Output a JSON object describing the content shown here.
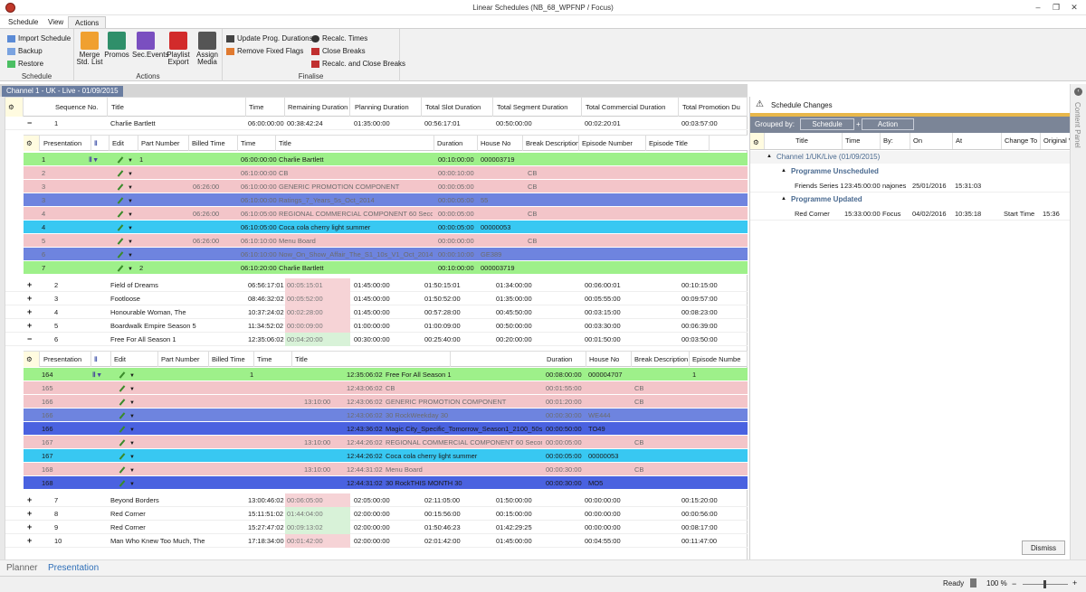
{
  "window": {
    "title": "Linear Schedules (NB_68_WPFNP / Focus)",
    "minimize": "–",
    "restore": "❐",
    "close": "✕"
  },
  "menu": {
    "tabs": [
      "Schedule",
      "View",
      "Actions"
    ],
    "active": "Actions"
  },
  "ribbon": {
    "schedule_group": {
      "label": "Schedule",
      "import": "Import Schedule",
      "backup": "Backup",
      "restore": "Restore"
    },
    "actions_group": {
      "label": "Actions",
      "merge": "Merge Std. List",
      "promos": "Promos",
      "sec_events": "Sec.Events",
      "playlist_export": "Playlist Export",
      "assign_media": "Assign Media"
    },
    "finalise_group": {
      "label": "Finalise",
      "update_prog": "Update Prog. Durations",
      "remove_fixed": "Remove Fixed Flags",
      "recalc_times": "Recalc. Times",
      "close_breaks": "Close Breaks",
      "recalc_close": "Recalc. and Close Breaks"
    }
  },
  "doc_tab": "Channel 1 - UK - Live - 01/09/2015",
  "main_headers": [
    "Sequence No.",
    "Title",
    "Time",
    "Remaining Duration",
    "Planning Duration",
    "Total Slot Duration",
    "Total Segment Duration",
    "Total Commercial Duration",
    "Total Promotion Du"
  ],
  "sub_headers_1": [
    "Presentation",
    "Edit",
    "Part Number",
    "Billed Time",
    "Time",
    "Title",
    "Duration",
    "House No",
    "Break Description",
    "Episode Number",
    "Episode Title"
  ],
  "sub_headers_2": [
    "Presentation",
    "Edit",
    "Part Number",
    "Billed Time",
    "Time",
    "Title",
    "Duration",
    "House No",
    "Break Description",
    "Episode Numbe"
  ],
  "programmes_top": [
    {
      "expander": "−",
      "seq": "1",
      "title": "Charlie Bartlett",
      "time": "06:00:00:00",
      "remaining": "00:38:42:24",
      "planning": "01:35:00:00",
      "slot": "00:56:17:01",
      "segment": "00:50:00:00",
      "commercial": "00:02:20:01",
      "promotion": "00:03:57:00"
    }
  ],
  "events_1": [
    {
      "color": "green",
      "pres": "1",
      "part": "1",
      "billed": "",
      "time": "06:00:00:00",
      "title": "Charlie Bartlett",
      "duration": "00:10:00:00",
      "house": "000003719",
      "brk": ""
    },
    {
      "color": "pink",
      "pres": "2",
      "part": "",
      "billed": "",
      "time": "06:10:00:00",
      "title": "CB",
      "duration": "00:00:10:00",
      "house": "",
      "brk": "CB"
    },
    {
      "color": "pink",
      "pres": "3",
      "part": "",
      "billed": "06:26:00",
      "time": "06:10:00:00",
      "title": "GENERIC PROMOTION COMPONENT",
      "duration": "00:00:05:00",
      "house": "",
      "brk": "CB"
    },
    {
      "color": "blue",
      "pres": "3",
      "part": "",
      "billed": "",
      "time": "06:10:00:00",
      "title": "Ratings_7_Years_5s_Oct_2014",
      "duration": "00:00:05:00",
      "house": "55",
      "brk": ""
    },
    {
      "color": "pink",
      "pres": "4",
      "part": "",
      "billed": "06:26:00",
      "time": "06:10:05:00",
      "title": "REGIONAL COMMERCIAL COMPONENT 60 Seconds",
      "duration": "00:00:05:00",
      "house": "",
      "brk": "CB"
    },
    {
      "color": "cyan",
      "pres": "4",
      "part": "",
      "billed": "",
      "time": "06:10:05:00",
      "title": "Coca cola cherry light summer",
      "duration": "00:00:05:00",
      "house": "00000053",
      "brk": ""
    },
    {
      "color": "pink",
      "pres": "5",
      "part": "",
      "billed": "06:26:00",
      "time": "06:10:10:00",
      "title": "Menu Board",
      "duration": "00:00:00:00",
      "house": "",
      "brk": "CB"
    },
    {
      "color": "blue",
      "pres": "6",
      "part": "",
      "billed": "",
      "time": "06:10:10:00",
      "title": "Now_On_Show_Affair_The_S1_10s_V1_Oct_2014",
      "duration": "00:00:10:00",
      "house": "GE389",
      "brk": ""
    },
    {
      "color": "green",
      "pres": "7",
      "part": "2",
      "billed": "",
      "time": "06:10:20:00",
      "title": "Charlie Bartlett",
      "duration": "00:10:00:00",
      "house": "000003719",
      "brk": ""
    }
  ],
  "programmes_mid": [
    {
      "expander": "+",
      "seq": "2",
      "title": "Field of Dreams",
      "time": "06:56:17:01",
      "remaining": "00:05:15:01",
      "rem_color": "pink",
      "planning": "01:45:00:00",
      "slot": "01:50:15:01",
      "segment": "01:34:00:00",
      "commercial": "00:06:00:01",
      "promotion": "00:10:15:00"
    },
    {
      "expander": "+",
      "seq": "3",
      "title": "Footloose",
      "time": "08:46:32:02",
      "remaining": "00:05:52:00",
      "rem_color": "pink",
      "planning": "01:45:00:00",
      "slot": "01:50:52:00",
      "segment": "01:35:00:00",
      "commercial": "00:05:55:00",
      "promotion": "00:09:57:00"
    },
    {
      "expander": "+",
      "seq": "4",
      "title": "Honourable Woman, The",
      "time": "10:37:24:02",
      "remaining": "00:02:28:00",
      "rem_color": "pink",
      "planning": "01:45:00:00",
      "slot": "00:57:28:00",
      "segment": "00:45:50:00",
      "commercial": "00:03:15:00",
      "promotion": "00:08:23:00"
    },
    {
      "expander": "+",
      "seq": "5",
      "title": "Boardwalk Empire Season 5",
      "time": "11:34:52:02",
      "remaining": "00:00:09:00",
      "rem_color": "pink",
      "planning": "01:00:00:00",
      "slot": "01:00:09:00",
      "segment": "00:50:00:00",
      "commercial": "00:03:30:00",
      "promotion": "00:06:39:00"
    },
    {
      "expander": "−",
      "seq": "6",
      "title": "Free For All Season 1",
      "time": "12:35:06:02",
      "remaining": "00:04:20:00",
      "rem_color": "green",
      "planning": "00:30:00:00",
      "slot": "00:25:40:00",
      "segment": "00:20:00:00",
      "commercial": "00:01:50:00",
      "promotion": "00:03:50:00"
    }
  ],
  "events_2": [
    {
      "color": "green",
      "pres": "164",
      "part": "1",
      "billed": "",
      "time": "12:35:06:02",
      "title": "Free For All Season 1",
      "duration": "00:08:00:00",
      "house": "000004707",
      "brk": "",
      "ep": "1"
    },
    {
      "color": "pink",
      "pres": "165",
      "part": "",
      "billed": "",
      "time": "12:43:06:02",
      "title": "CB",
      "duration": "00:01:55:00",
      "house": "",
      "brk": "CB",
      "ep": ""
    },
    {
      "color": "pink",
      "pres": "166",
      "part": "",
      "billed": "13:10:00",
      "time": "12:43:06:02",
      "title": "GENERIC PROMOTION COMPONENT",
      "duration": "00:01:20:00",
      "house": "",
      "brk": "CB",
      "ep": ""
    },
    {
      "color": "blue",
      "pres": "166",
      "part": "",
      "billed": "",
      "time": "12:43:06:02",
      "title": "30 RockWeekday 30",
      "duration": "00:00:30:00",
      "house": "WE444",
      "brk": "",
      "ep": ""
    },
    {
      "color": "dblue",
      "pres": "166",
      "part": "",
      "billed": "",
      "time": "12:43:36:02",
      "title": "Magic City_Specific_Tomorrow_Season1_2100_50s",
      "duration": "00:00:50:00",
      "house": "TO49",
      "brk": "",
      "ep": ""
    },
    {
      "color": "pink",
      "pres": "167",
      "part": "",
      "billed": "13:10:00",
      "time": "12:44:26:02",
      "title": "REGIONAL COMMERCIAL COMPONENT 60 Seconds",
      "duration": "00:00:05:00",
      "house": "",
      "brk": "CB",
      "ep": ""
    },
    {
      "color": "cyan",
      "pres": "167",
      "part": "",
      "billed": "",
      "time": "12:44:26:02",
      "title": "Coca cola cherry light summer",
      "duration": "00:00:05:00",
      "house": "00000053",
      "brk": "",
      "ep": ""
    },
    {
      "color": "pink",
      "pres": "168",
      "part": "",
      "billed": "13:10:00",
      "time": "12:44:31:02",
      "title": "Menu Board",
      "duration": "00:00:30:00",
      "house": "",
      "brk": "CB",
      "ep": ""
    },
    {
      "color": "dblue",
      "pres": "168",
      "part": "",
      "billed": "",
      "time": "12:44:31:02",
      "title": "30 RockTHIS MONTH 30",
      "duration": "00:00:30:00",
      "house": "MO5",
      "brk": "",
      "ep": ""
    }
  ],
  "programmes_bottom": [
    {
      "expander": "+",
      "seq": "7",
      "title": "Beyond Borders",
      "time": "13:00:46:02",
      "remaining": "00:06:05:00",
      "rem_color": "pink",
      "planning": "02:05:00:00",
      "slot": "02:11:05:00",
      "segment": "01:50:00:00",
      "commercial": "00:00:00:00",
      "promotion": "00:15:20:00"
    },
    {
      "expander": "+",
      "seq": "8",
      "title": "Red Corner",
      "time": "15:11:51:02",
      "remaining": "01:44:04:00",
      "rem_color": "green",
      "planning": "02:00:00:00",
      "slot": "00:15:56:00",
      "segment": "00:15:00:00",
      "commercial": "00:00:00:00",
      "promotion": "00:00:56:00"
    },
    {
      "expander": "+",
      "seq": "9",
      "title": "Red Corner",
      "time": "15:27:47:02",
      "remaining": "00:09:13:02",
      "rem_color": "green",
      "planning": "02:00:00:00",
      "slot": "01:50:46:23",
      "segment": "01:42:29:25",
      "commercial": "00:00:00:00",
      "promotion": "00:08:17:00"
    },
    {
      "expander": "+",
      "seq": "10",
      "title": "Man Who Knew Too Much, The",
      "time": "17:18:34:00",
      "remaining": "00:01:42:00",
      "rem_color": "pink",
      "planning": "02:00:00:00",
      "slot": "02:01:42:00",
      "segment": "01:45:00:00",
      "commercial": "00:04:55:00",
      "promotion": "00:11:47:00"
    }
  ],
  "changes": {
    "title": "Schedule Changes",
    "grouped_by": "Grouped by:",
    "group_chip": "Schedule",
    "action_chip": "Action",
    "plus": "+",
    "headers": [
      "Title",
      "Time",
      "By:",
      "On",
      "At",
      "Change To",
      "Original Value"
    ],
    "channel_group": "Channel 1/UK/Live (01/09/2015)",
    "groups": [
      {
        "name": "Programme Unscheduled",
        "rows": [
          {
            "title": "Friends Series 1",
            "time": "23:45:00:00",
            "by": "najones",
            "on": "25/01/2016",
            "at": "15:31:03",
            "change": "",
            "orig": ""
          }
        ]
      },
      {
        "name": "Programme Updated",
        "rows": [
          {
            "title": "Red Corner",
            "time": "15:33:00:00",
            "by": "Focus",
            "on": "04/02/2016",
            "at": "10:35:18",
            "change": "Start Time",
            "orig": "15:36"
          }
        ]
      }
    ],
    "dismiss": "Dismiss"
  },
  "side_panel_label": "Content Panel",
  "bottom_tabs": [
    "Planner",
    "Presentation"
  ],
  "status": {
    "ready": "Ready",
    "zoom": "100 %"
  },
  "colors": {
    "green": "#9ef08a",
    "pink": "#f3c5c9",
    "blue": "#6e84df",
    "dblue": "#4a62e0",
    "cyan": "#38c8f2",
    "accent": "#e8b74a"
  }
}
